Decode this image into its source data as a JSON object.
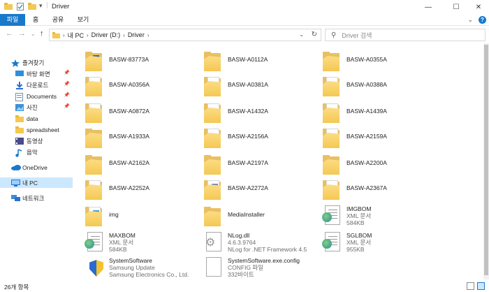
{
  "window": {
    "title": "Driver"
  },
  "ribbon": {
    "tabs": [
      "파일",
      "홈",
      "공유",
      "보기"
    ],
    "help": "?"
  },
  "address": {
    "crumbs": [
      "내 PC",
      "Driver (D:)",
      "Driver"
    ],
    "search_placeholder": "Driver 검색"
  },
  "nav": {
    "items": [
      {
        "label": "즐겨찾기",
        "icon": "star-icon"
      },
      {
        "label": "바탕 화면",
        "icon": "desktop-icon",
        "pinned": true
      },
      {
        "label": "다운로드",
        "icon": "download-icon",
        "pinned": true
      },
      {
        "label": "Documents",
        "icon": "documents-icon",
        "pinned": true
      },
      {
        "label": "사진",
        "icon": "pictures-icon",
        "pinned": true
      },
      {
        "label": "data",
        "icon": "folder-icon"
      },
      {
        "label": "spreadsheet",
        "icon": "folder-icon"
      },
      {
        "label": "동영상",
        "icon": "videos-icon"
      },
      {
        "label": "음악",
        "icon": "music-icon"
      },
      {
        "label": "OneDrive",
        "icon": "cloud-icon"
      },
      {
        "label": "내 PC",
        "icon": "pc-icon",
        "selected": true
      },
      {
        "label": "네트워크",
        "icon": "network-icon"
      }
    ]
  },
  "files": [
    {
      "name": "BASW-83773A",
      "type": "folder",
      "mark": "blue"
    },
    {
      "name": "BASW-A0112A",
      "type": "folder"
    },
    {
      "name": "BASW-A0355A",
      "type": "folder"
    },
    {
      "name": "BASW-A0356A",
      "type": "folder-paper"
    },
    {
      "name": "BASW-A0381A",
      "type": "folder-paper"
    },
    {
      "name": "BASW-A0388A",
      "type": "folder-paper"
    },
    {
      "name": "BASW-A0872A",
      "type": "folder-paper"
    },
    {
      "name": "BASW-A1432A",
      "type": "folder-paper",
      "mark": "small"
    },
    {
      "name": "BASW-A1439A",
      "type": "folder-paper",
      "mark": "small"
    },
    {
      "name": "BASW-A1933A",
      "type": "folder"
    },
    {
      "name": "BASW-A2156A",
      "type": "folder-paper",
      "mark": "small"
    },
    {
      "name": "BASW-A2159A",
      "type": "folder-paper",
      "mark": "small"
    },
    {
      "name": "BASW-A2162A",
      "type": "folder"
    },
    {
      "name": "BASW-A2197A",
      "type": "folder"
    },
    {
      "name": "BASW-A2200A",
      "type": "folder"
    },
    {
      "name": "BASW-A2252A",
      "type": "folder-paper"
    },
    {
      "name": "BASW-A2272A",
      "type": "folder-paper",
      "mark": "gray"
    },
    {
      "name": "BASW-A2367A",
      "type": "folder-paper"
    },
    {
      "name": "img",
      "type": "folder-paper",
      "mark": "cyan"
    },
    {
      "name": "MediaInstaller",
      "type": "folder"
    },
    {
      "name": "IMGBOM",
      "type": "xml",
      "sub1": "XML 문서",
      "sub2": "584KB"
    },
    {
      "name": "MAXBOM",
      "type": "xml",
      "sub1": "XML 문서",
      "sub2": "584KB"
    },
    {
      "name": "NLog.dll",
      "type": "dll",
      "sub1": "4.6.3.9764",
      "sub2": "NLog for .NET Framework 4.5"
    },
    {
      "name": "SGLBOM",
      "type": "xml",
      "sub1": "XML 문서",
      "sub2": "955KB"
    },
    {
      "name": "SystemSoftware",
      "type": "exe",
      "sub1": "Samsung Update",
      "sub2": "Samsung Electronics Co., Ltd."
    },
    {
      "name": "SystemSoftware.exe.config",
      "type": "config",
      "sub1": "CONFIG 파일",
      "sub2": "332바이트"
    }
  ],
  "status": {
    "count": "26개 항목"
  },
  "colors": {
    "accent": "#1979ca",
    "folder": "#f4c853",
    "selection": "#cce8ff"
  }
}
